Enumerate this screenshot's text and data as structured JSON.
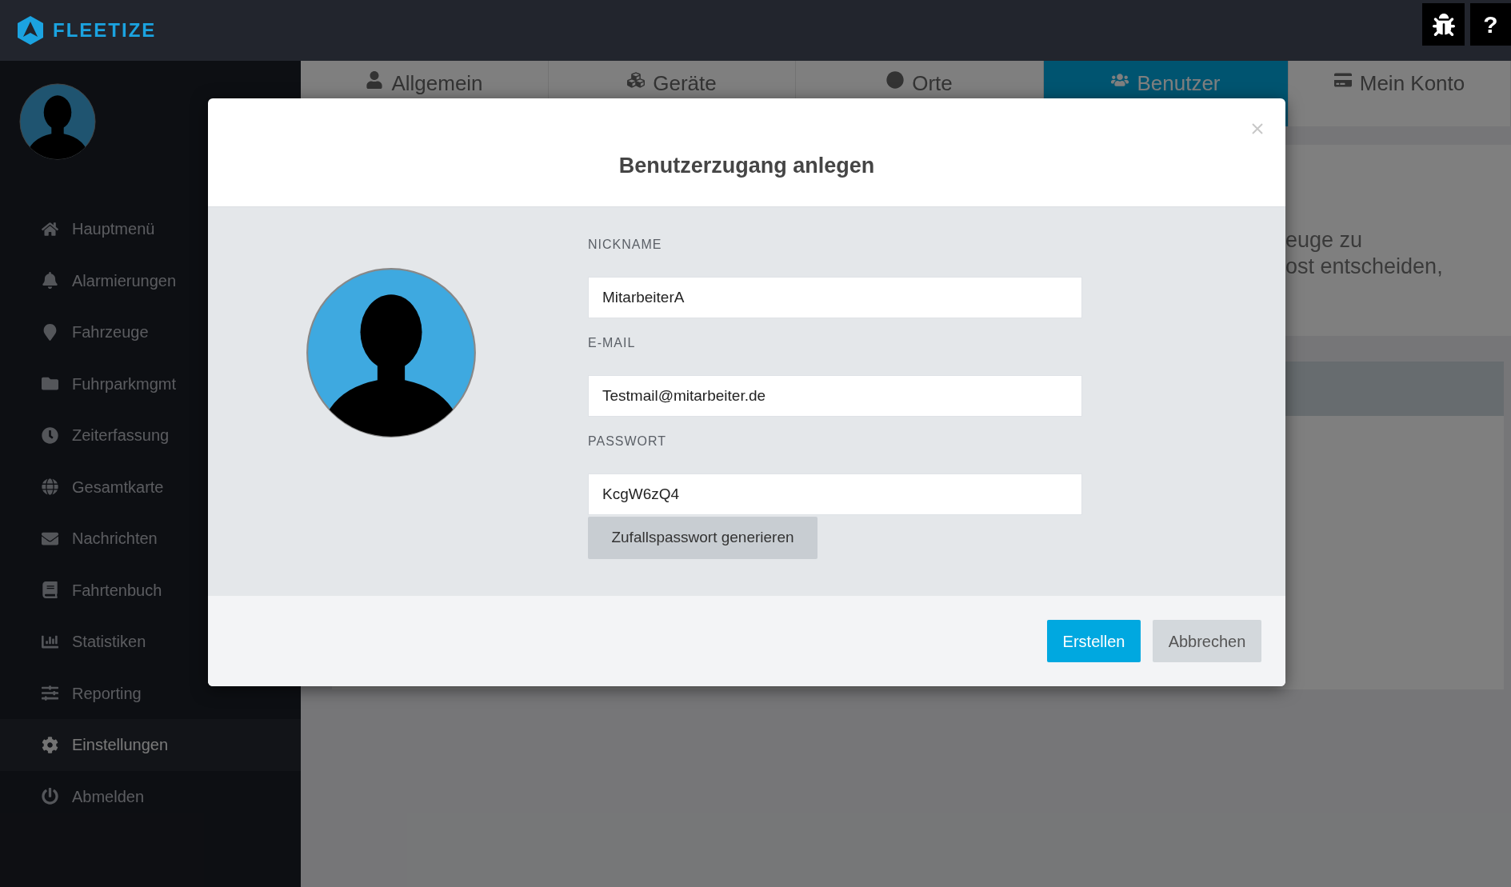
{
  "header": {
    "logo_text": "FLEETIZE",
    "help_label": "?"
  },
  "sidebar": {
    "items": [
      {
        "label": "Hauptmenü",
        "selected": false
      },
      {
        "label": "Alarmierungen",
        "selected": false
      },
      {
        "label": "Fahrzeuge",
        "selected": false
      },
      {
        "label": "Fuhrparkmgmt",
        "selected": false
      },
      {
        "label": "Zeiterfassung",
        "selected": false
      },
      {
        "label": "Gesamtkarte",
        "selected": false
      },
      {
        "label": "Nachrichten",
        "selected": false
      },
      {
        "label": "Fahrtenbuch",
        "selected": false
      },
      {
        "label": "Statistiken",
        "selected": false
      },
      {
        "label": "Reporting",
        "selected": false
      },
      {
        "label": "Einstellungen",
        "selected": true
      },
      {
        "label": "Abmelden",
        "selected": false
      }
    ]
  },
  "tabs": [
    {
      "label": "Allgemein",
      "selected": false
    },
    {
      "label": "Geräte",
      "selected": false
    },
    {
      "label": "Orte",
      "selected": false
    },
    {
      "label": "Benutzer",
      "selected": true
    },
    {
      "label": "Mein Konto",
      "selected": false
    }
  ],
  "intro_lines": [
    "euge zu",
    "ost entscheiden,"
  ],
  "modal": {
    "title": "Benutzerzugang anlegen",
    "fields": [
      {
        "label": "NICKNAME",
        "value": "MitarbeiterA"
      },
      {
        "label": "E-MAIL",
        "value": "Testmail@mitarbeiter.de"
      },
      {
        "label": "PASSWORT",
        "value": "KcgW6zQ4"
      }
    ],
    "generate_button": "Zufallspasswort generieren",
    "buttons": [
      {
        "label": "Erstellen",
        "kind": "primary"
      },
      {
        "label": "Abbrechen",
        "kind": "secondary"
      }
    ]
  }
}
